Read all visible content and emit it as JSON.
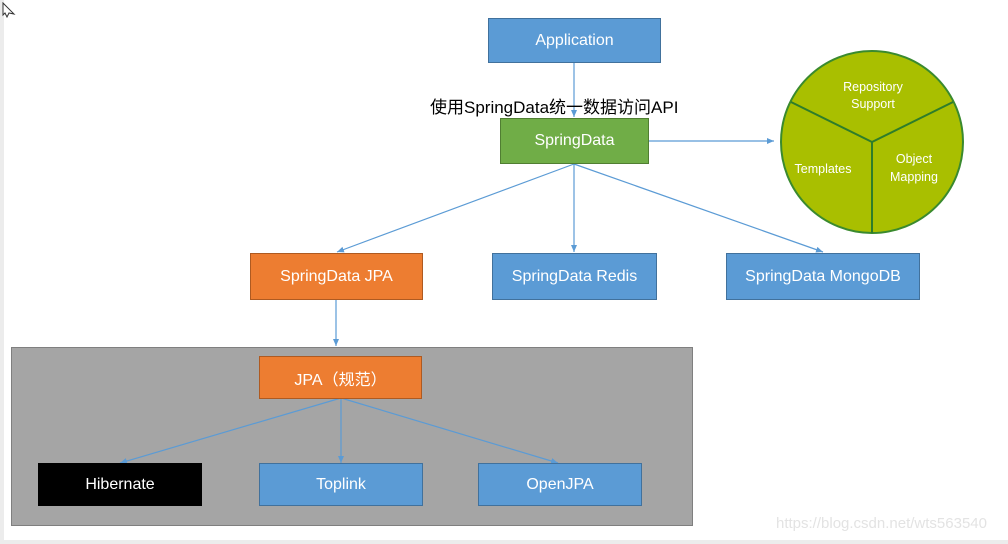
{
  "diagram": {
    "title_label": "使用SpringData统一数据访问API",
    "nodes": {
      "application": "Application",
      "springdata": "SpringData",
      "springdata_jpa": "SpringData JPA",
      "springdata_redis": "SpringData Redis",
      "springdata_mongodb": "SpringData MongoDB",
      "jpa_spec": "JPA（规范）",
      "hibernate": "Hibernate",
      "toplink": "Toplink",
      "openjpa": "OpenJPA"
    },
    "feature_circle": {
      "segments": [
        {
          "line1": "Repository",
          "line2": "Support"
        },
        {
          "line1": "Templates",
          "line2": ""
        },
        {
          "line1": "Object",
          "line2": "Mapping"
        }
      ]
    },
    "colors": {
      "blue": "#5b9bd5",
      "green": "#70ad47",
      "orange": "#ed7d31",
      "circle": "#a9bf00",
      "container": "#a5a5a5",
      "connector": "#5b9bd5"
    }
  },
  "watermark": "https://blog.csdn.net/wts563540"
}
